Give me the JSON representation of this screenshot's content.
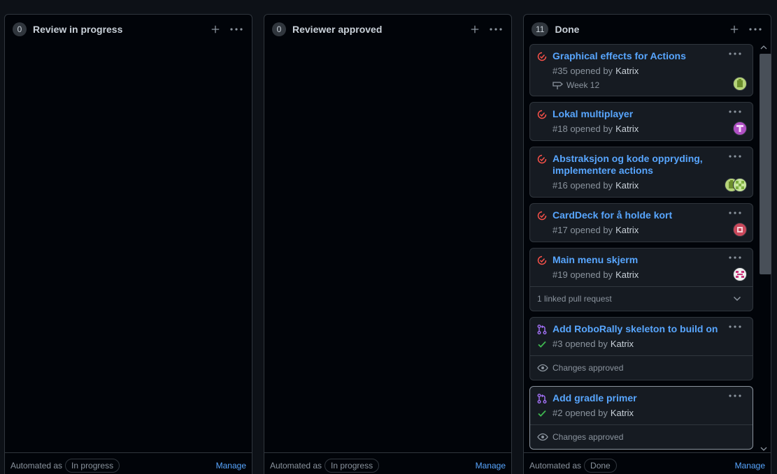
{
  "columns": [
    {
      "count": "0",
      "title": "Review in progress",
      "footer_label": "Automated as",
      "footer_badge": "In progress",
      "manage": "Manage"
    },
    {
      "count": "0",
      "title": "Reviewer approved",
      "footer_label": "Automated as",
      "footer_badge": "In progress",
      "manage": "Manage"
    },
    {
      "count": "11",
      "title": "Done",
      "footer_label": "Automated as",
      "footer_badge": "Done",
      "manage": "Manage",
      "cards": [
        {
          "title": "Graphical effects for Actions",
          "number": "#35",
          "opened_by": "opened by",
          "author": "Katrix",
          "milestone": "Week 12",
          "type": "issue-closed"
        },
        {
          "title": "Lokal multiplayer",
          "number": "#18",
          "opened_by": "opened by",
          "author": "Katrix",
          "type": "issue-closed"
        },
        {
          "title": "Abstraksjon og kode oppryding, implementere actions",
          "number": "#16",
          "opened_by": "opened by",
          "author": "Katrix",
          "type": "issue-closed"
        },
        {
          "title": "CardDeck for å holde kort",
          "number": "#17",
          "opened_by": "opened by",
          "author": "Katrix",
          "type": "issue-closed"
        },
        {
          "title": "Main menu skjerm",
          "number": "#19",
          "opened_by": "opened by",
          "author": "Katrix",
          "linked": "1 linked pull request",
          "type": "issue-closed"
        },
        {
          "title": "Add RoboRally skeleton to build on",
          "number": "#3",
          "opened_by": "opened by",
          "author": "Katrix",
          "review": "Changes approved",
          "type": "pull-request"
        },
        {
          "title": "Add gradle primer",
          "number": "#2",
          "opened_by": "opened by",
          "author": "Katrix",
          "review": "Changes approved",
          "type": "pull-request"
        }
      ]
    }
  ],
  "colors": {
    "background": "#0d1117",
    "column_bg": "#010409",
    "card_bg": "#161b22",
    "border": "#30363d",
    "link": "#58a6ff",
    "closed_issue": "#f85149",
    "pull_request": "#a371f7",
    "success": "#3fb950",
    "muted": "#8b949e"
  }
}
